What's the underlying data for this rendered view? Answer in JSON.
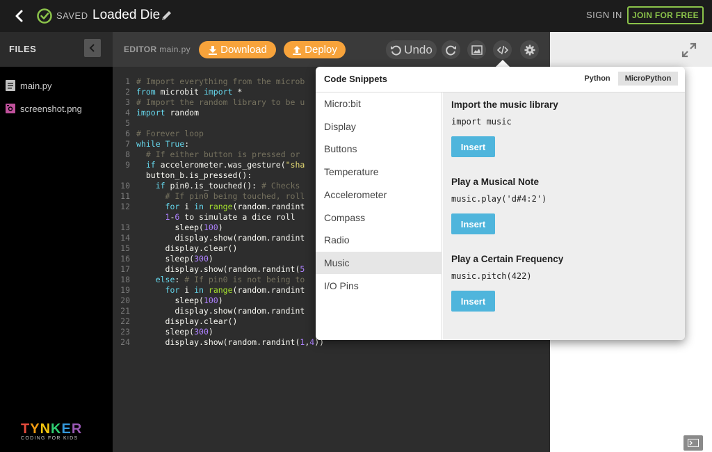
{
  "header": {
    "saved_label": "SAVED",
    "project_title": "Loaded Die",
    "sign_in_label": "SIGN IN",
    "join_label": "JOIN FOR FREE"
  },
  "files": {
    "title": "FILES",
    "items": [
      {
        "name": "main.py",
        "icon": "file-icon"
      },
      {
        "name": "screenshot.png",
        "icon": "image-file-icon"
      }
    ],
    "logo": {
      "main": "TYNKER",
      "sub": "CODING FOR KIDS"
    }
  },
  "editor": {
    "label": "EDITOR",
    "filename": "main.py",
    "download_label": "Download",
    "deploy_label": "Deploy",
    "undo_label": "Undo",
    "lines": [
      {
        "n": "1",
        "t": "# Import everything from the microb"
      },
      {
        "n": "2",
        "t": "from microbit import *"
      },
      {
        "n": "3",
        "t": "# Import the random library to be u"
      },
      {
        "n": "4",
        "t": "import random"
      },
      {
        "n": "5",
        "t": ""
      },
      {
        "n": "6",
        "t": "# Forever loop"
      },
      {
        "n": "7",
        "t": "while True:"
      },
      {
        "n": "8",
        "t": "  # If either button is pressed or "
      },
      {
        "n": "9",
        "t": "  if accelerometer.was_gesture(\"sha"
      },
      {
        "n": "",
        "t": "  button_b.is_pressed():"
      },
      {
        "n": "10",
        "t": "    if pin0.is_touched(): # Checks "
      },
      {
        "n": "11",
        "t": "      # If pin0 being touched, roll"
      },
      {
        "n": "12",
        "t": "      for i in range(random.randint"
      },
      {
        "n": "",
        "t": "      1-6 to simulate a dice roll"
      },
      {
        "n": "13",
        "t": "        sleep(100)"
      },
      {
        "n": "14",
        "t": "        display.show(random.randint"
      },
      {
        "n": "15",
        "t": "      display.clear()"
      },
      {
        "n": "16",
        "t": "      sleep(300)"
      },
      {
        "n": "17",
        "t": "      display.show(random.randint(5"
      },
      {
        "n": "18",
        "t": "    else: # If pin0 is not being to"
      },
      {
        "n": "19",
        "t": "      for i in range(random.randint"
      },
      {
        "n": "20",
        "t": "        sleep(100)"
      },
      {
        "n": "21",
        "t": "        display.show(random.randint"
      },
      {
        "n": "22",
        "t": "      display.clear()"
      },
      {
        "n": "23",
        "t": "      sleep(300)"
      },
      {
        "n": "24",
        "t": "      display.show(random.randint(1,4))"
      }
    ]
  },
  "snippets": {
    "title": "Code Snippets",
    "lang_python": "Python",
    "lang_micropython": "MicroPython",
    "categories": [
      "Micro:bit",
      "Display",
      "Buttons",
      "Temperature",
      "Accelerometer",
      "Compass",
      "Radio",
      "Music",
      "I/O Pins"
    ],
    "active_category": "Music",
    "items": [
      {
        "title": "Import the music library",
        "code": "import music",
        "button": "Insert"
      },
      {
        "title": "Play a Musical Note",
        "code": "music.play('d#4:2')",
        "button": "Insert"
      },
      {
        "title": "Play a Certain Frequency",
        "code": "music.pitch(422)",
        "button": "Insert"
      }
    ]
  },
  "colors": {
    "accent_orange": "#f7a33b",
    "join_green": "#8bc34a",
    "insert_blue": "#4fb5dc",
    "comment": "#75715e",
    "keyword": "#66d9ef",
    "string": "#e6db74",
    "number": "#ae81ff",
    "builtin": "#a6e22e"
  }
}
